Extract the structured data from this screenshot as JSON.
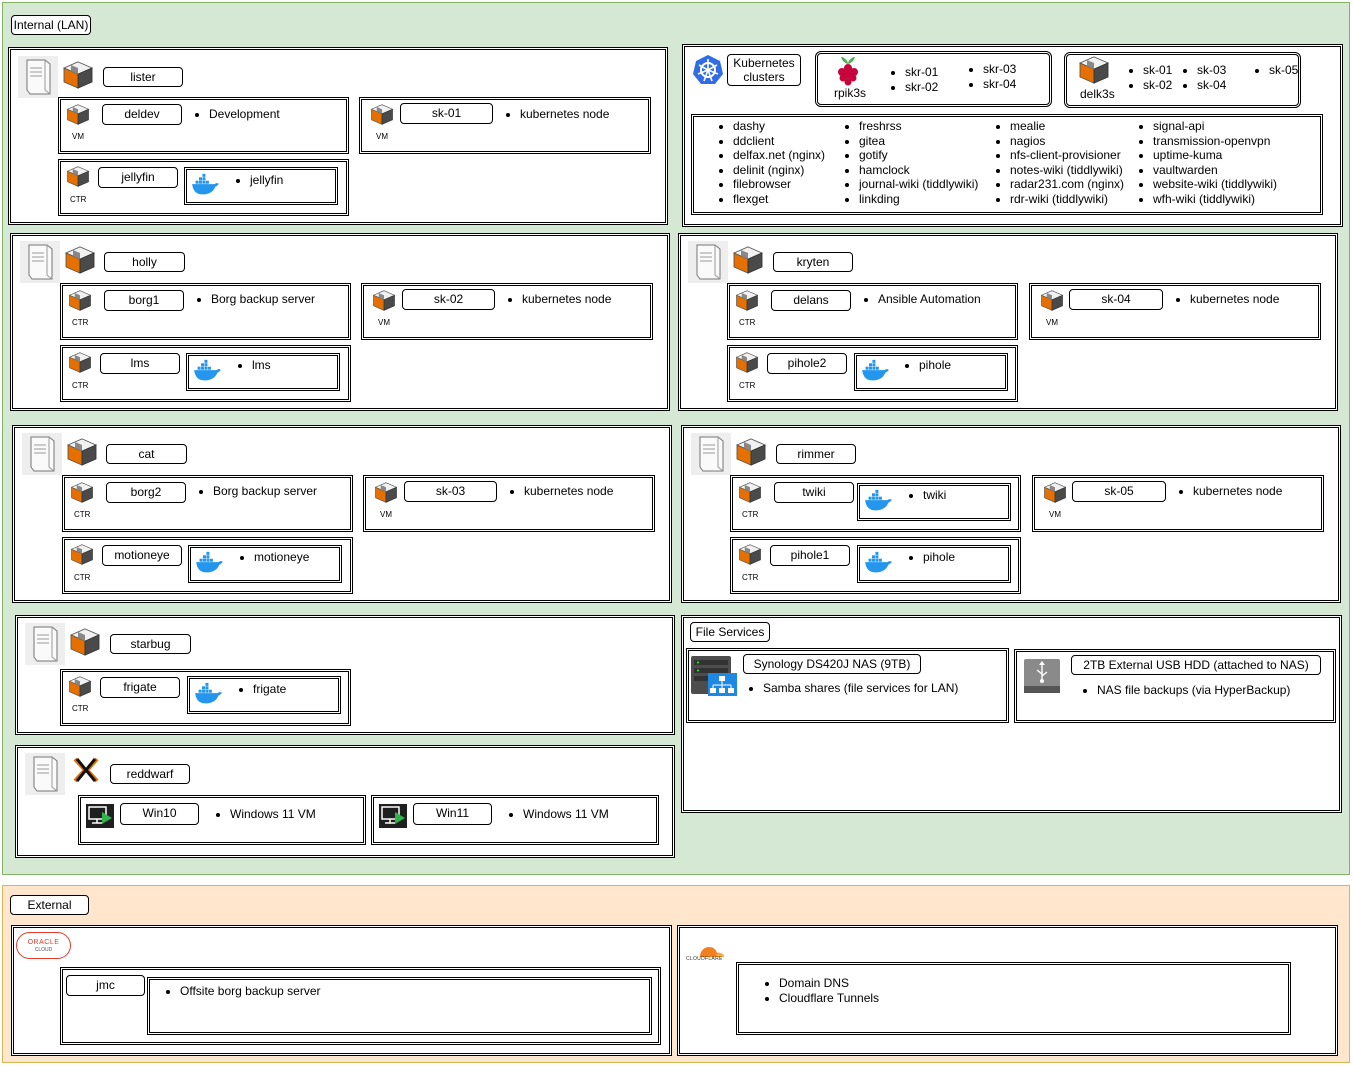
{
  "zones": {
    "internal": "Internal (LAN)",
    "external": "External"
  },
  "colors": {
    "internal_fill": "#d5e8d4",
    "internal_border": "#82b366",
    "external_fill": "#ffe6cc",
    "external_border": "#d6b656",
    "proxmox_orange": "#e57000"
  },
  "tags": {
    "vm": "VM",
    "ctr": "CTR"
  },
  "hosts": {
    "lister": {
      "name": "lister",
      "deldev": {
        "name": "deldev",
        "items": [
          "Development"
        ]
      },
      "sk01": {
        "name": "sk-01",
        "items": [
          "kubernetes node"
        ]
      },
      "jellyfin": {
        "name": "jellyfin",
        "docker": [
          "jellyfin"
        ]
      }
    },
    "holly": {
      "name": "holly",
      "borg1": {
        "name": "borg1",
        "items": [
          "Borg backup server"
        ]
      },
      "sk02": {
        "name": "sk-02",
        "items": [
          "kubernetes node"
        ]
      },
      "lms": {
        "name": "lms",
        "docker": [
          "lms"
        ]
      }
    },
    "kryten": {
      "name": "kryten",
      "delans": {
        "name": "delans",
        "items": [
          "Ansible Automation"
        ]
      },
      "sk04": {
        "name": "sk-04",
        "items": [
          "kubernetes node"
        ]
      },
      "pihole2": {
        "name": "pihole2",
        "docker": [
          "pihole"
        ]
      }
    },
    "cat": {
      "name": "cat",
      "borg2": {
        "name": "borg2",
        "items": [
          "Borg backup server"
        ]
      },
      "sk03": {
        "name": "sk-03",
        "items": [
          "kubernetes node"
        ]
      },
      "motioneye": {
        "name": "motioneye",
        "docker": [
          "motioneye"
        ]
      }
    },
    "rimmer": {
      "name": "rimmer",
      "twiki": {
        "name": "twiki",
        "docker": [
          "twiki"
        ]
      },
      "sk05": {
        "name": "sk-05",
        "items": [
          "kubernetes node"
        ]
      },
      "pihole1": {
        "name": "pihole1",
        "docker": [
          "pihole"
        ]
      }
    },
    "starbug": {
      "name": "starbug",
      "frigate": {
        "name": "frigate",
        "docker": [
          "frigate"
        ]
      }
    },
    "reddwarf": {
      "name": "reddwarf",
      "win10": {
        "name": "Win10",
        "items": [
          "Windows 11 VM"
        ]
      },
      "win11": {
        "name": "Win11",
        "items": [
          "Windows 11 VM"
        ]
      }
    }
  },
  "kubernetes": {
    "title": "Kubernetes clusters",
    "rpik3s": {
      "name": "rpik3s",
      "col1": [
        "skr-01",
        "skr-02"
      ],
      "col2": [
        "skr-03",
        "skr-04"
      ]
    },
    "delk3s": {
      "name": "delk3s",
      "col1": [
        "sk-01",
        "sk-02"
      ],
      "col2": [
        "sk-03",
        "sk-04"
      ],
      "col3": [
        "sk-05"
      ]
    },
    "apps": [
      [
        "dashy",
        "ddclient",
        "delfax.net (nginx)",
        "delinit (nginx)",
        "filebrowser",
        "flexget"
      ],
      [
        "freshrss",
        "gitea",
        "gotify",
        "hamclock",
        "journal-wiki (tiddlywiki)",
        "linkding"
      ],
      [
        "mealie",
        "nagios",
        "nfs-client-provisioner",
        "notes-wiki (tiddlywiki)",
        "radar231.com (nginx)",
        "rdr-wiki (tiddlywiki)"
      ],
      [
        "signal-api",
        "transmission-openvpn",
        "uptime-kuma",
        "vaultwarden",
        "website-wiki (tiddlywiki)",
        "wfh-wiki (tiddlywiki)"
      ]
    ]
  },
  "file_services": {
    "title": "File Services",
    "nas": {
      "name": "Synology DS420J NAS (9TB)",
      "items": [
        "Samba shares (file services for LAN)"
      ]
    },
    "usb": {
      "name": "2TB External USB HDD (attached to NAS)",
      "items": [
        "NAS file backups (via HyperBackup)"
      ]
    }
  },
  "external": {
    "oracle": {
      "logo_text": "ORACLE",
      "logo_sub": "CLOUD",
      "jmc": {
        "name": "jmc",
        "items": [
          "Offsite borg backup server"
        ]
      }
    },
    "cloudflare": {
      "logo_text": "CLOUDFLARE",
      "items": [
        "Domain DNS",
        "Cloudflare Tunnels"
      ]
    }
  }
}
